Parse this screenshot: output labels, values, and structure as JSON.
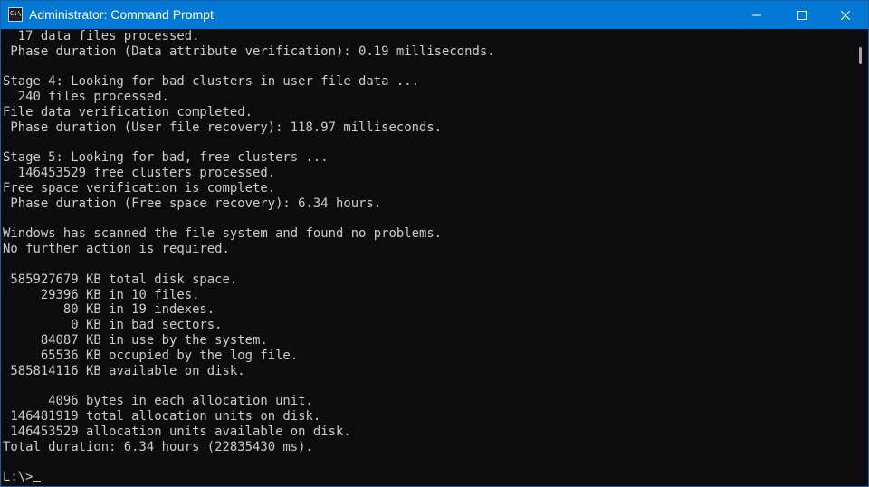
{
  "window": {
    "title": "Administrator: Command Prompt",
    "icon": "cmd-icon",
    "icon_text": "C:\\",
    "controls": [
      "minimize-icon",
      "maximize-icon",
      "close-icon"
    ]
  },
  "console": {
    "lines": [
      "  17 data files processed.",
      " Phase duration (Data attribute verification): 0.19 milliseconds.",
      "",
      "Stage 4: Looking for bad clusters in user file data ...",
      "  240 files processed.",
      "File data verification completed.",
      " Phase duration (User file recovery): 118.97 milliseconds.",
      "",
      "Stage 5: Looking for bad, free clusters ...",
      "  146453529 free clusters processed.",
      "Free space verification is complete.",
      " Phase duration (Free space recovery): 6.34 hours.",
      "",
      "Windows has scanned the file system and found no problems.",
      "No further action is required.",
      "",
      " 585927679 KB total disk space.",
      "     29396 KB in 10 files.",
      "        80 KB in 19 indexes.",
      "         0 KB in bad sectors.",
      "     84087 KB in use by the system.",
      "     65536 KB occupied by the log file.",
      " 585814116 KB available on disk.",
      "",
      "      4096 bytes in each allocation unit.",
      " 146481919 total allocation units on disk.",
      " 146453529 allocation units available on disk.",
      "Total duration: 6.34 hours (22835430 ms).",
      "",
      "L:\\>"
    ]
  },
  "colors": {
    "titlebar": "#0078d4",
    "background": "#0c0c0c",
    "text": "#cccccc"
  }
}
